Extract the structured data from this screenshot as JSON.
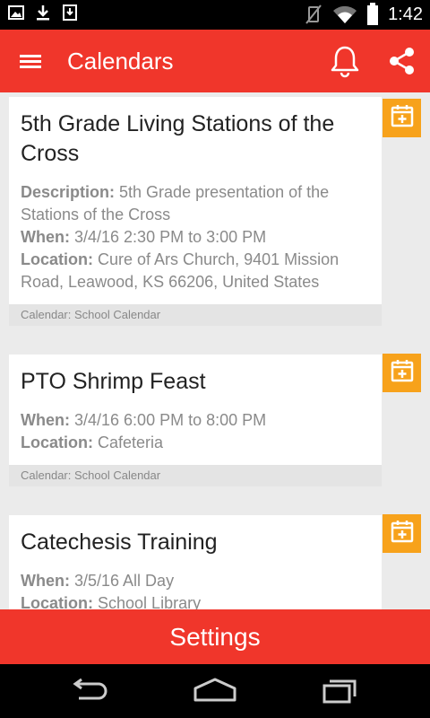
{
  "status_bar": {
    "time": "1:42",
    "left_icons": [
      "image-icon",
      "download-icon",
      "download-box-icon"
    ],
    "right_icons": [
      "vibrate-muted-icon",
      "wifi-icon",
      "battery-icon"
    ]
  },
  "app_bar": {
    "title": "Calendars",
    "menu_icon": "hamburger-menu-icon",
    "actions": [
      "bell-icon",
      "share-icon"
    ],
    "color": "#f0362b"
  },
  "events": [
    {
      "title": "5th Grade Living Stations of the Cross",
      "description_label": "Description:",
      "description": "5th Grade presentation of the Stations of the Cross",
      "when_label": "When:",
      "when": "3/4/16 2:30 PM to 3:00 PM",
      "location_label": "Location:",
      "location": "Cure of Ars Church, 9401 Mission Road, Leawood, KS 66206, United States",
      "calendar": "Calendar: School Calendar"
    },
    {
      "title": "PTO Shrimp Feast",
      "when_label": "When:",
      "when": "3/4/16 6:00 PM to 8:00 PM",
      "location_label": "Location:",
      "location": "Cafeteria",
      "calendar": "Calendar: School Calendar"
    },
    {
      "title": "Catechesis Training",
      "when_label": "When:",
      "when": "3/5/16 All Day",
      "location_label": "Location:",
      "location": "School Library"
    }
  ],
  "add_to_calendar_color": "#f7a21b",
  "settings_label": "Settings",
  "nav_bar": [
    "back-icon",
    "home-icon",
    "recents-icon"
  ]
}
